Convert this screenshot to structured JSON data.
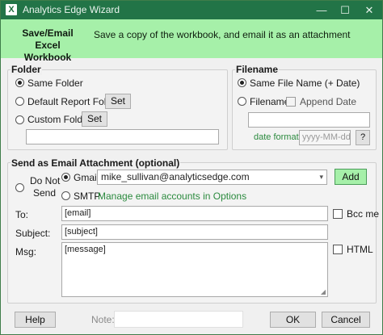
{
  "window": {
    "title": "Analytics Edge Wizard",
    "app_icon": "X",
    "icons": {
      "minimize": "—",
      "maximize": "☐",
      "close": "✕"
    }
  },
  "header": {
    "title_line1": "Save/Email",
    "title_line2": "Excel Workbook",
    "description": "Save a copy of the workbook, and email it as an attachment",
    "band_color": "#a6f0a9"
  },
  "folder": {
    "title": "Folder",
    "options": [
      {
        "label": "Same Folder",
        "selected": true
      },
      {
        "label": "Default Report Folder",
        "selected": false,
        "button": "Set"
      },
      {
        "label": "Custom Folder",
        "selected": false,
        "button": "Set"
      }
    ],
    "path_value": ""
  },
  "filename": {
    "title": "Filename",
    "opt_same": "Same File Name (+ Date)",
    "opt_filename": "Filename",
    "append_date_label": "Append Date",
    "filename_value": "",
    "date_format_label": "date format",
    "date_format_placeholder": "yyyy-MM-dd",
    "help_label": "?"
  },
  "email": {
    "title": "Send as Email Attachment (optional)",
    "do_not_send_line1": "Do Not",
    "do_not_send_line2": "Send",
    "gmail_label": "Gmail",
    "account_value": "mike_sullivan@analyticsedge.com",
    "add_label": "Add",
    "smtp_label": "SMTP",
    "manage_link": "Manage email accounts in Options",
    "to_label": "To:",
    "to_value": "[email]",
    "bcc_label": "Bcc me",
    "subject_label": "Subject:",
    "subject_value": "[subject]",
    "msg_label": "Msg:",
    "msg_value": "[message]",
    "html_label": "HTML"
  },
  "footer": {
    "help_label": "Help",
    "note_label": "Note:",
    "note_value": "",
    "ok_label": "OK",
    "cancel_label": "Cancel"
  },
  "colors": {
    "titlebar": "#227447",
    "accent_green": "#2b8a3e"
  }
}
